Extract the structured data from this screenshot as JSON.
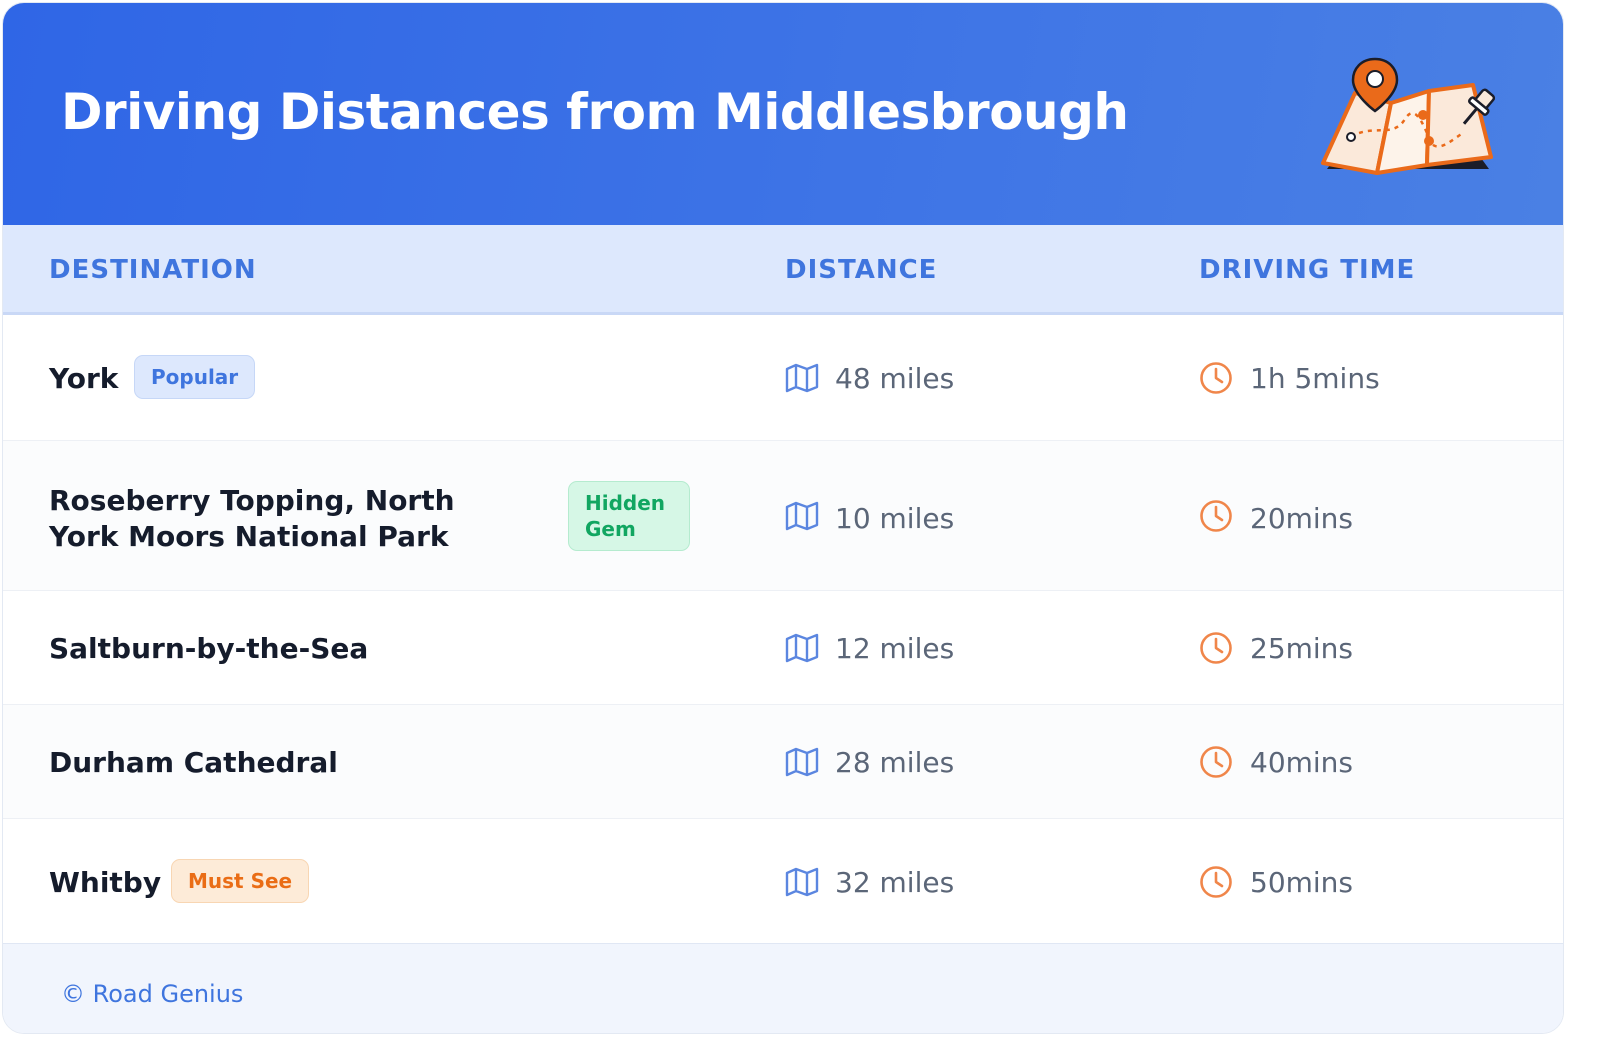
{
  "header": {
    "title": "Driving Distances from Middlesbrough",
    "illustration": "map-with-pins-icon"
  },
  "table": {
    "columns": [
      "DESTINATION",
      "DISTANCE",
      "DRIVING TIME"
    ],
    "rows": [
      {
        "destination": "York",
        "badge": "Popular",
        "badge_color": "blue",
        "distance": "48 miles",
        "time": "1h 5mins"
      },
      {
        "destination": "Roseberry Topping, North York Moors National Park",
        "badge": "Hidden Gem",
        "badge_color": "green",
        "distance": "10 miles",
        "time": "20mins"
      },
      {
        "destination": "Saltburn-by-the-Sea",
        "badge": "",
        "badge_color": "",
        "distance": "12 miles",
        "time": "25mins"
      },
      {
        "destination": "Durham Cathedral",
        "badge": "",
        "badge_color": "",
        "distance": "28 miles",
        "time": "40mins"
      },
      {
        "destination": "Whitby",
        "badge": "Must See",
        "badge_color": "orange",
        "distance": "32 miles",
        "time": "50mins"
      }
    ],
    "icons": {
      "distance": "map-icon",
      "time": "clock-icon"
    }
  },
  "footer": {
    "copyright": "© Road Genius"
  },
  "colors": {
    "header_gradient_start": "#2f66e6",
    "header_gradient_end": "#4a80e4",
    "accent_blue": "#3f75de",
    "map_icon": "#5b86e0",
    "clock_icon": "#f0864a",
    "badge_green": "#11a661",
    "badge_orange": "#ea6d16"
  }
}
